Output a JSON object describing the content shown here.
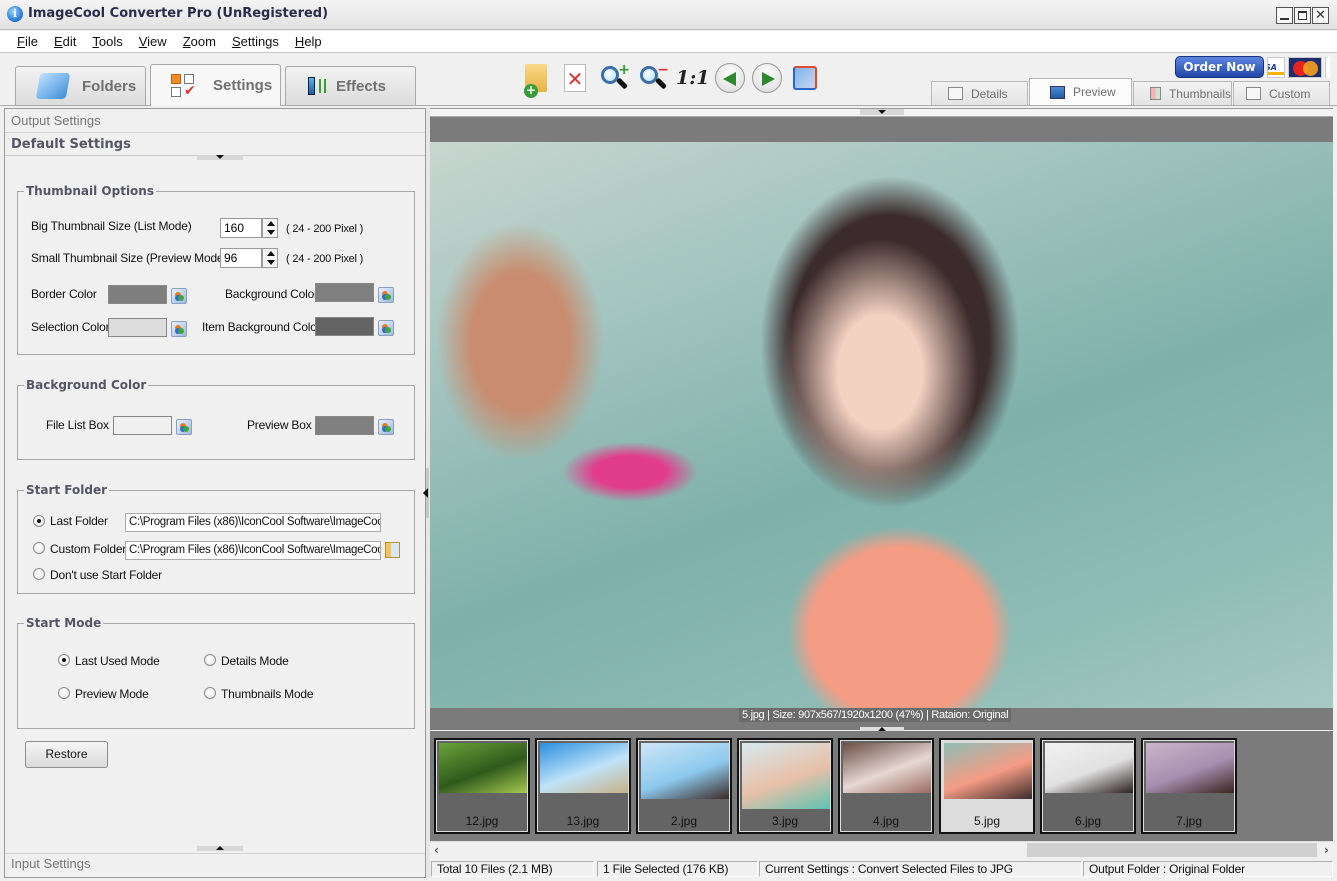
{
  "window": {
    "title": "ImageCool Converter Pro  (UnRegistered)",
    "controls": {
      "minimize": "minimize",
      "maximize": "maximize",
      "close": "✕"
    }
  },
  "menu": [
    {
      "label": "File",
      "accel": "F"
    },
    {
      "label": "Edit",
      "accel": "E"
    },
    {
      "label": "Tools",
      "accel": "T"
    },
    {
      "label": "View",
      "accel": "V"
    },
    {
      "label": "Zoom",
      "accel": "Z"
    },
    {
      "label": "Settings",
      "accel": "S"
    },
    {
      "label": "Help",
      "accel": "H"
    }
  ],
  "main_tabs": [
    {
      "label": "Folders",
      "icon": "folder-icon",
      "active": false
    },
    {
      "label": "Settings",
      "icon": "settings-checklist-icon",
      "active": true
    },
    {
      "label": "Effects",
      "icon": "effects-sliders-icon",
      "active": false
    }
  ],
  "toolbar": {
    "buttons": [
      {
        "name": "add-folder",
        "icon": "add-folder-icon"
      },
      {
        "name": "delete-file",
        "icon": "delete-icon"
      },
      {
        "name": "zoom-in",
        "icon": "zoom-in-icon"
      },
      {
        "name": "zoom-out",
        "icon": "zoom-out-icon"
      },
      {
        "name": "actual-size",
        "icon": "actual-size-icon",
        "text": "1:1"
      },
      {
        "name": "previous-image",
        "icon": "arrow-left-icon"
      },
      {
        "name": "next-image",
        "icon": "arrow-right-icon"
      },
      {
        "name": "rotate",
        "icon": "rotate-icon"
      }
    ],
    "order_now": "Order Now",
    "payment_cards": [
      "VISA",
      "MasterCard"
    ]
  },
  "view_tabs": [
    {
      "label": "Details",
      "active": false
    },
    {
      "label": "Preview",
      "active": true
    },
    {
      "label": "Thumbnails",
      "active": false
    },
    {
      "label": "Custom",
      "active": false
    }
  ],
  "left_panel": {
    "output_settings": "Output Settings",
    "default_settings": "Default Settings",
    "input_settings": "Input Settings",
    "thumbnail_options": {
      "legend": "Thumbnail Options",
      "big_label": "Big Thumbnail Size (List Mode)",
      "big_value": "160",
      "big_range": "( 24 - 200 Pixel )",
      "small_label": "Small Thumbnail Size (Preview Mode)",
      "small_value": "96",
      "small_range": "( 24 - 200 Pixel )",
      "border_color_label": "Border Color",
      "border_color": "#7f7f7f",
      "background_color_label": "Background Color",
      "background_color": "#808080",
      "selection_color_label": "Selection Color",
      "selection_color": "#dcdcdc",
      "item_bg_color_label": "Item Background Color",
      "item_bg_color": "#646464"
    },
    "background_color": {
      "legend": "Background Color",
      "file_list_label": "File List Box",
      "file_list_color": "#f0f0f0",
      "preview_label": "Preview Box",
      "preview_color": "#808080"
    },
    "start_folder": {
      "legend": "Start Folder",
      "options": [
        {
          "label": "Last Folder",
          "checked": true,
          "path": "C:\\Program Files (x86)\\IconCool Software\\ImageCoo"
        },
        {
          "label": "Custom Folder",
          "checked": false,
          "path": "C:\\Program Files (x86)\\IconCool Software\\ImageCoo"
        },
        {
          "label": "Don't use Start Folder",
          "checked": false
        }
      ]
    },
    "start_mode": {
      "legend": "Start Mode",
      "options": [
        {
          "label": "Last Used Mode",
          "checked": true
        },
        {
          "label": "Details Mode",
          "checked": false
        },
        {
          "label": "Preview Mode",
          "checked": false
        },
        {
          "label": "Thumbnails Mode",
          "checked": false
        }
      ]
    },
    "restore_label": "Restore"
  },
  "preview": {
    "image_desc": "Preview of 5.jpg: woman in coral top standing in a pool",
    "info": "5.jpg  |  Size: 907x567/1920x1200 (47%)  |  Rataion: Original"
  },
  "thumbnails": [
    {
      "name": "12.jpg",
      "colors": [
        "#6aa23a",
        "#2f5a1c",
        "#a7c94e"
      ],
      "selected": false
    },
    {
      "name": "13.jpg",
      "colors": [
        "#2b8fe0",
        "#bfe3f8",
        "#c8b089"
      ],
      "selected": false
    },
    {
      "name": "2.jpg",
      "colors": [
        "#cfe6f7",
        "#8cc9ee",
        "#3d2a25"
      ],
      "selected": false
    },
    {
      "name": "3.jpg",
      "colors": [
        "#d6e9f0",
        "#e8c0a8",
        "#5ec3b3"
      ],
      "selected": false
    },
    {
      "name": "4.jpg",
      "colors": [
        "#6b4d46",
        "#e6d8d3",
        "#9a6c62"
      ],
      "selected": false
    },
    {
      "name": "5.jpg",
      "colors": [
        "#8fbcb6",
        "#f59c84",
        "#3b2b2c"
      ],
      "selected": true
    },
    {
      "name": "6.jpg",
      "colors": [
        "#f2f2f2",
        "#e1e1e1",
        "#2a2020"
      ],
      "selected": false
    },
    {
      "name": "7.jpg",
      "colors": [
        "#c9b6c8",
        "#a68fb0",
        "#3a2520"
      ],
      "selected": false
    }
  ],
  "status": {
    "total": "Total 10 Files (2.1 MB)",
    "selected": "1 File Selected (176 KB)",
    "current_settings": "Current Settings : Convert Selected Files to JPG",
    "output_folder": "Output Folder : Original Folder"
  }
}
